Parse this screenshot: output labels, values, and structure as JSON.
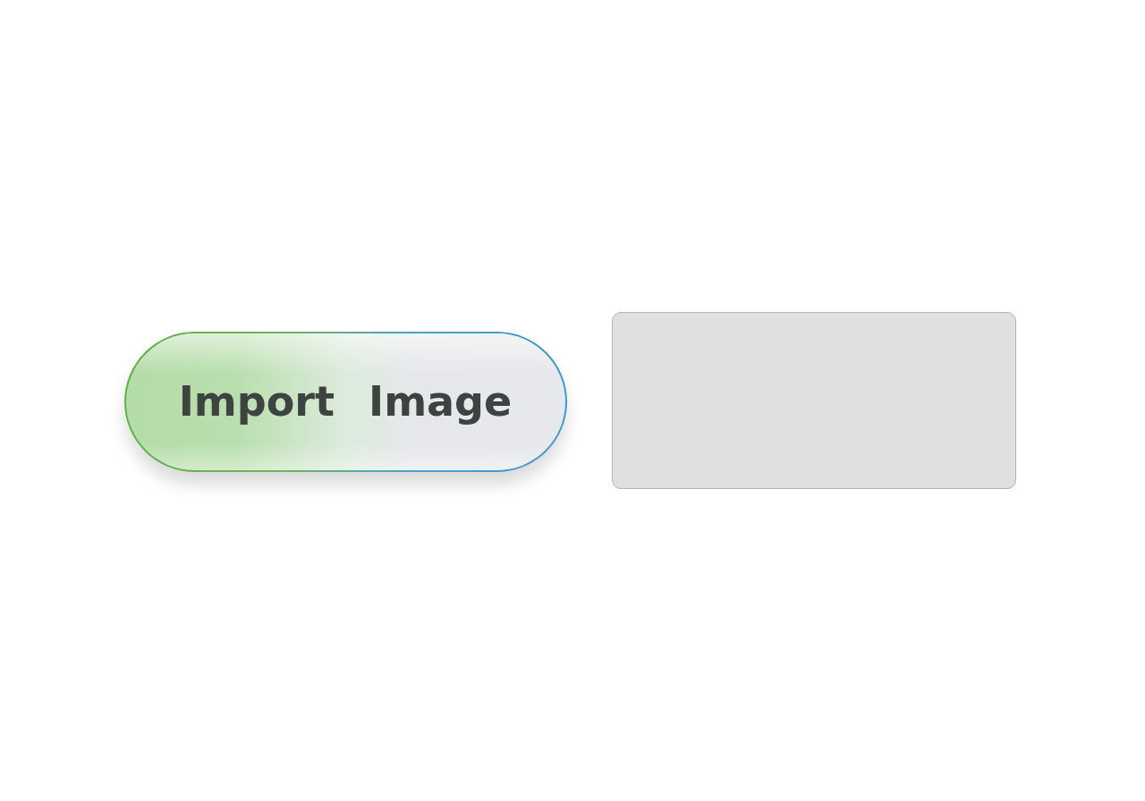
{
  "import_button": {
    "label": "Import Image"
  }
}
